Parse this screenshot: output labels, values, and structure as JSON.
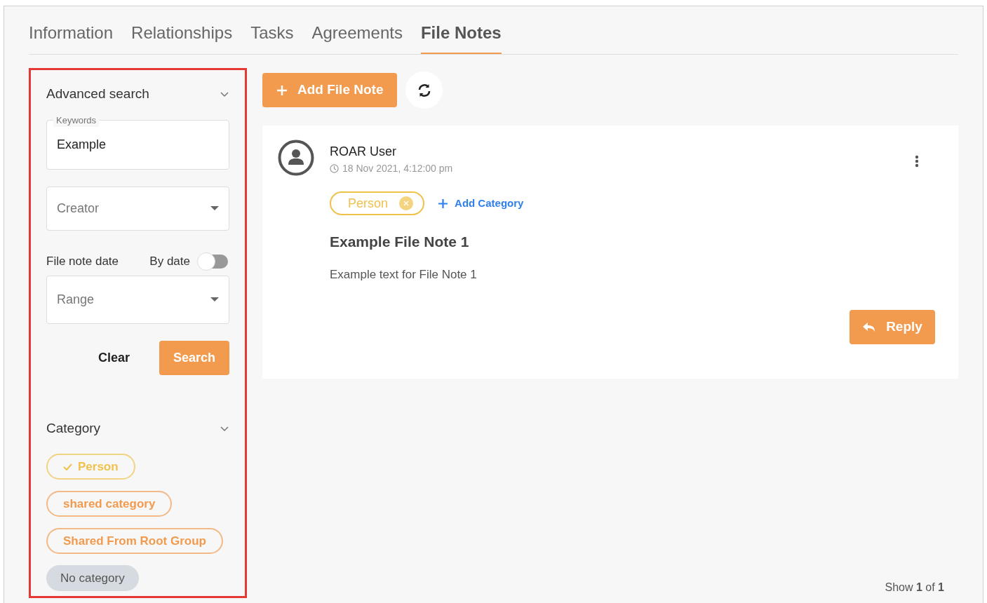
{
  "tabs": [
    {
      "label": "Information",
      "selected": false
    },
    {
      "label": "Relationships",
      "selected": false
    },
    {
      "label": "Tasks",
      "selected": false
    },
    {
      "label": "Agreements",
      "selected": false
    },
    {
      "label": "File Notes",
      "selected": true
    }
  ],
  "advanced_search": {
    "title": "Advanced search",
    "expanded": true,
    "keywords": {
      "label": "Keywords",
      "value": "Example"
    },
    "creator": {
      "placeholder": "Creator"
    },
    "date_label": "File note date",
    "by_date": {
      "label": "By date",
      "on": false
    },
    "range": {
      "placeholder": "Range"
    },
    "clear": "Clear",
    "search": "Search"
  },
  "category_filter": {
    "title": "Category",
    "expanded": true,
    "items": [
      {
        "label": "Person",
        "selected": true,
        "color": "#f0c14b"
      },
      {
        "label": "shared category",
        "selected": false,
        "color": "#f29a4e"
      },
      {
        "label": "Shared From Root Group",
        "selected": false,
        "color": "#f29a4e"
      },
      {
        "label": "No category",
        "selected": false,
        "kind": "none"
      }
    ]
  },
  "add_button": "Add File Note",
  "note": {
    "author": "ROAR User",
    "time": "18 Nov 2021, 4:12:00 pm",
    "categories": [
      {
        "label": "Person",
        "color": "#f0c14b"
      }
    ],
    "add_category": "Add Category",
    "title": "Example File Note 1",
    "body": "Example text for File Note 1",
    "reply": "Reply"
  },
  "pager": "Show **1** of **1**"
}
